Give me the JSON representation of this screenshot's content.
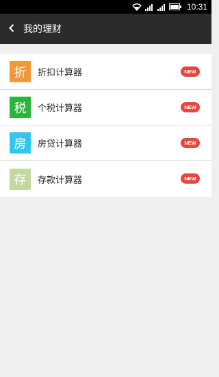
{
  "status_bar": {
    "time": "10:31"
  },
  "header": {
    "title": "我的理财"
  },
  "colors": {
    "badge": "#e8473d"
  },
  "calculators": [
    {
      "icon_char": "折",
      "label": "折扣计算器",
      "badge": "NEW",
      "icon_color": "#f0983a"
    },
    {
      "icon_char": "税",
      "label": "个税计算器",
      "badge": "NEW",
      "icon_color": "#2bb33a"
    },
    {
      "icon_char": "房",
      "label": "房贷计算器",
      "badge": "NEW",
      "icon_color": "#32c7ef"
    },
    {
      "icon_char": "存",
      "label": "存款计算器",
      "badge": "NEW",
      "icon_color": "#c3d7a0"
    }
  ]
}
